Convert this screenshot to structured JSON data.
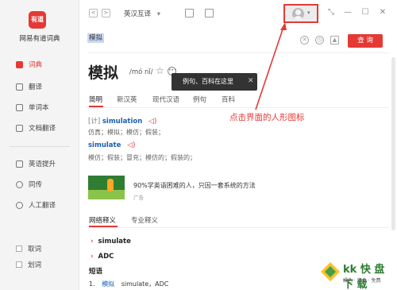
{
  "app": {
    "logo_text": "有道",
    "name": "网易有道词典"
  },
  "sidebar": {
    "items": [
      {
        "label": "词典",
        "active": true
      },
      {
        "label": "翻译"
      },
      {
        "label": "单词本"
      },
      {
        "label": "文档翻译"
      },
      {
        "label": "英语提升"
      },
      {
        "label": "同传"
      },
      {
        "label": "人工翻译"
      }
    ],
    "checks": [
      {
        "label": "取词"
      },
      {
        "label": "划词"
      }
    ]
  },
  "topbar": {
    "back": "<",
    "forward": ">",
    "language": "英汉互译",
    "language_caret": "▾",
    "user_caret": "▾"
  },
  "search": {
    "value": "模拟",
    "query_label": "查 询"
  },
  "entry": {
    "word": "模拟",
    "phonetic": "/mó nǐ/",
    "tooltip": "例句、百科在这里",
    "tabs": [
      "简明",
      "新汉英",
      "现代汉语",
      "例句",
      "百科"
    ],
    "defs": [
      {
        "tag": "[计]",
        "term": "simulation",
        "meaning": "仿真；模拟；模仿；假装；"
      },
      {
        "tag": "",
        "term": "simulate",
        "meaning": "模仿；假装；冒充；模仿的；假装的；"
      }
    ]
  },
  "annotation": {
    "text": "点击界面的人形图标",
    "color": "#e53935"
  },
  "ad": {
    "text": "90%学英语困难的人，只因一套系统的方法",
    "tag": "广告"
  },
  "lower": {
    "tabs": [
      "网络释义",
      "专业释义"
    ],
    "items": [
      "simulate",
      "ADC"
    ],
    "phrase_head": "短语",
    "phrase": {
      "index": "1.",
      "term": "模拟",
      "rest": "simulate，ADC"
    }
  },
  "watermark": {
    "brand": "kk 快 盘 下 载",
    "tagline": "绿色 · 安全 · 免费"
  },
  "colors": {
    "accent": "#e53935",
    "link": "#1a5fb4"
  }
}
